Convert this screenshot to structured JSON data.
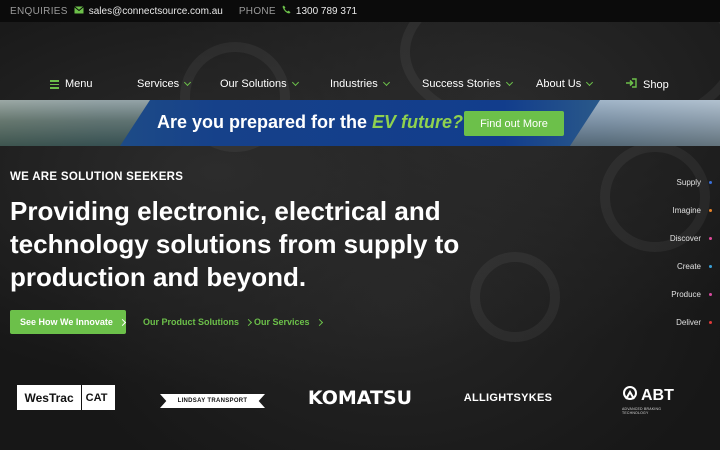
{
  "topbar": {
    "enquiries_label": "ENQUIRIES",
    "email": "sales@connectsource.com.au",
    "phone_label": "PHONE",
    "phone": "1300 789 371"
  },
  "nav": {
    "items": [
      {
        "label": "Menu"
      },
      {
        "label": "Services"
      },
      {
        "label": "Our Solutions"
      },
      {
        "label": "Industries"
      },
      {
        "label": "Success Stories"
      },
      {
        "label": "About Us"
      },
      {
        "label": "Shop"
      }
    ]
  },
  "banner": {
    "text_prefix": "Are you prepared for the ",
    "text_emphasis": "EV future?",
    "button_label": "Find out More"
  },
  "hero": {
    "kicker": "WE ARE SOLUTION SEEKERS",
    "headline": "Providing electronic, electrical and technology solutions from supply to production and beyond.",
    "cta_primary": "See How We Innovate",
    "cta_products": "Our Product Solutions",
    "cta_services": "Our Services"
  },
  "side_nav": {
    "items": [
      {
        "label": "Supply",
        "color": "#3a6fd8"
      },
      {
        "label": "Imagine",
        "color": "#e8842a"
      },
      {
        "label": "Discover",
        "color": "#e04a9a"
      },
      {
        "label": "Create",
        "color": "#3aa0d8"
      },
      {
        "label": "Produce",
        "color": "#d84aa0"
      },
      {
        "label": "Deliver",
        "color": "#e03a3a"
      }
    ]
  },
  "logos": {
    "westrac": "WesTrac",
    "cat": "CAT",
    "lindsay": "LINDSAY TRANSPORT",
    "komatsu": "KOMATSU",
    "allightsykes": "ALLIGHTSYKES",
    "abt": "ABT",
    "abt_sub": "ADVANCED BRAKING TECHNOLOGY"
  },
  "colors": {
    "accent": "#6cc04a",
    "topbar_bg": "#0b0b0b",
    "banner_blue": "#16418a"
  }
}
